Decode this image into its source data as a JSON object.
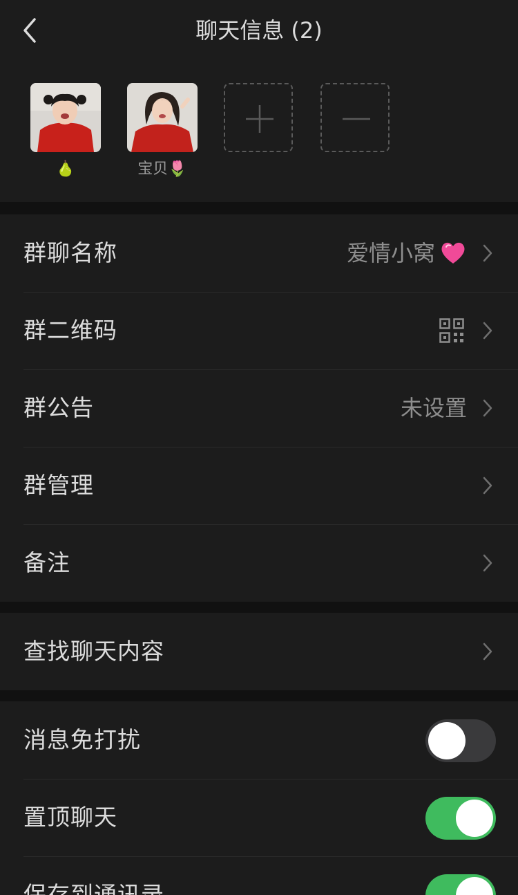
{
  "header": {
    "title": "聊天信息 (2)"
  },
  "members": [
    {
      "name": "🍐"
    },
    {
      "name": "宝贝🌷"
    }
  ],
  "group": {
    "name_label": "群聊名称",
    "name_value": "爱情小窝",
    "qrcode_label": "群二维码",
    "notice_label": "群公告",
    "notice_value": "未设置",
    "manage_label": "群管理",
    "remark_label": "备注"
  },
  "search": {
    "label": "查找聊天内容"
  },
  "settings": {
    "mute_label": "消息免打扰",
    "mute_on": false,
    "pin_label": "置顶聊天",
    "pin_on": true,
    "save_label": "保存到通讯录",
    "save_on": true
  },
  "colors": {
    "toggle_on": "#3fbb5e",
    "toggle_off": "#3a3a3c",
    "background": "#111111",
    "panel": "#1c1c1c"
  }
}
